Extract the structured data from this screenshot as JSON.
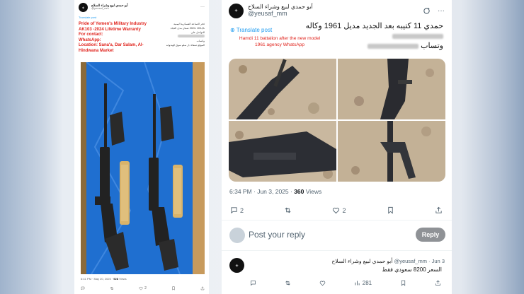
{
  "left_post": {
    "account_name": "أبو حمدي لبيع وشراء السلاح",
    "handle": "@yeusaf_mm",
    "translate_label": "Translate post",
    "english_caption": [
      "Pride of Yemen's Military Industry",
      "AK103 -2024 Lifetime Warranty",
      "For contact:",
      "WhatsApp:",
      "Location: Sana'a, Dar Salam, Al-",
      "Hindwana Market"
    ],
    "arabic_caption": [
      "فخر الصناعة العسكرية اليمنية",
      "ناك103 -2024 ضمان مدى الحياة",
      "للتواصل على",
      "واتساب",
      "الموقع صنعاء دار سلم سوق الهندوانه"
    ],
    "meta_time": "6:41 PM · May 20, 2025 ·",
    "meta_views": "928",
    "meta_views_label": "Views",
    "actions": {
      "replies": "",
      "reposts": "",
      "likes": "2",
      "bookmarks": ""
    }
  },
  "right_post": {
    "account_name": "أبو حمدي لبيع وشراء السلاح",
    "handle": "@yeusaf_mm",
    "arabic_text_line1": "حمدي 11 كتيبه بعد الجديد مديل 1961 وكاله",
    "arabic_text_line2": "وتساب",
    "translate_label": "Translate post",
    "translation": "Hamdi 11 battalion after the new model 1961 agency WhatsApp",
    "meta_time": "6:34 PM · Jun 3, 2025 ·",
    "meta_views": "360",
    "meta_views_label": "Views",
    "actions": {
      "replies": "2",
      "reposts": "",
      "likes": "2",
      "bookmarks": ""
    },
    "reply_placeholder": "Post your reply",
    "reply_button": "Reply"
  },
  "reply_post": {
    "account_name": "أبو حمدي لبيع وشراء السلاح",
    "handle": "@yeusaf_mm",
    "date": "Jun 3",
    "text": "السعر 8200 سعودي فقط",
    "views": "281"
  },
  "colors": {
    "link_blue": "#1d9bf0",
    "caption_red": "#e0231c",
    "muted": "#536471",
    "tarp_blue": "#1f6fd0"
  }
}
